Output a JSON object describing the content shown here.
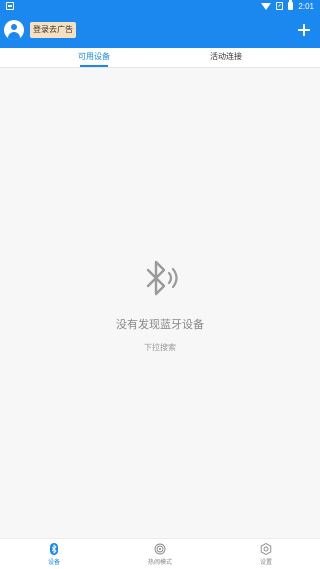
{
  "status_bar": {
    "time": "2:01"
  },
  "header": {
    "login_ad_label": "登录去广告",
    "icons": {
      "avatar": "user-avatar-icon",
      "add": "plus-icon"
    },
    "accent": "#1a88ee"
  },
  "tabs": [
    {
      "label": "可用设备",
      "selected": true
    },
    {
      "label": "活动连接",
      "selected": false
    }
  ],
  "empty_state": {
    "icon": "bluetooth-searching-icon",
    "title": "没有发现蓝牙设备",
    "hint": "下拉搜索"
  },
  "bottom_nav": [
    {
      "label": "设备",
      "icon": "bluetooth-icon",
      "selected": true
    },
    {
      "label": "热闹模式",
      "icon": "broadcast-icon",
      "selected": false
    },
    {
      "label": "设置",
      "icon": "gear-icon",
      "selected": false
    }
  ]
}
